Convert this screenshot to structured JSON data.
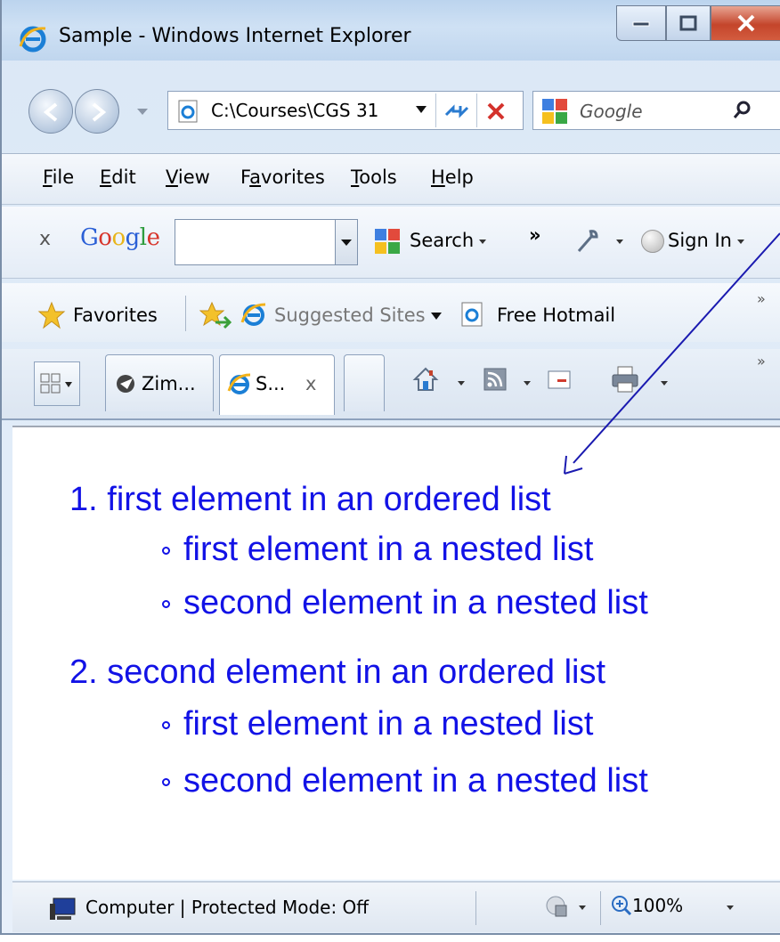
{
  "window": {
    "title": "Sample - Windows Internet Explorer"
  },
  "navigation": {
    "address": "C:\\Courses\\CGS 31",
    "search_placeholder": "Google"
  },
  "menu": {
    "items": [
      {
        "label": "File",
        "accel": "F",
        "rest": "ile"
      },
      {
        "label": "Edit",
        "accel": "E",
        "rest": "dit"
      },
      {
        "label": "View",
        "accel": "V",
        "rest": "iew"
      },
      {
        "label": "Favorites",
        "accel_prefix": "F",
        "accel": "a",
        "rest": "vorites"
      },
      {
        "label": "Tools",
        "accel": "T",
        "rest": "ools"
      },
      {
        "label": "Help",
        "accel": "H",
        "rest": "elp"
      }
    ]
  },
  "google_toolbar": {
    "close_label": "x",
    "logo": "Google",
    "search_label": "Search",
    "more_label": "»",
    "sign_in_label": "Sign In"
  },
  "favorites_bar": {
    "favorites_label": "Favorites",
    "suggested_sites_label": "Suggested Sites",
    "free_hotmail_label": "Free Hotmail",
    "chevron": "»"
  },
  "tabs": {
    "items": [
      {
        "label": "Zim..."
      },
      {
        "label": "S...",
        "close": "x",
        "active": true
      }
    ],
    "chevron": "»"
  },
  "content": {
    "ordered_list": [
      {
        "marker": "1.",
        "text": "first element in an ordered list",
        "nested": [
          "first element in a nested list",
          "second element in a nested list"
        ]
      },
      {
        "marker": "2.",
        "text": "second element in an ordered list",
        "nested": [
          "first element in a nested list",
          "second element in a nested list"
        ]
      }
    ],
    "text_color": "#1212e6"
  },
  "status_bar": {
    "zone_text": "Computer | Protected Mode: Off",
    "zoom": "100%"
  }
}
